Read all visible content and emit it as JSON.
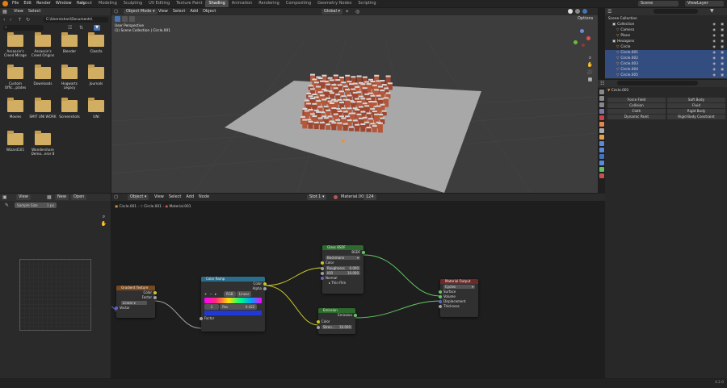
{
  "topbar": {
    "menus": [
      "File",
      "Edit",
      "Render",
      "Window",
      "Help"
    ],
    "workspaces": [
      "Layout",
      "Modeling",
      "Sculpting",
      "UV Editing",
      "Texture Paint",
      "Shading",
      "Animation",
      "Rendering",
      "Compositing",
      "Geometry Nodes",
      "Scripting"
    ],
    "active_workspace": "Shading",
    "scene": "Scene",
    "view_layer": "ViewLayer"
  },
  "file_browser": {
    "menus": [
      "View",
      "Select"
    ],
    "path": "C:\\Users\\shari\\Documents\\",
    "folders": [
      "Assassin's Creed Mirage",
      "Assassin's Creed Origins",
      "Blender",
      "Classfa",
      "Custom Offic...plates",
      "Downloads",
      "Hogwarts Legacy",
      "Journals",
      "Movies",
      "SMIT UNI WORK",
      "Screenshots",
      "UNI",
      "Wizard101",
      "Wondershare Demo...eror 8"
    ]
  },
  "viewport": {
    "mode": "Object Mode",
    "menus": [
      "View",
      "Select",
      "Add",
      "Object"
    ],
    "transform": "Global",
    "overlay_line1": "User Perspective",
    "overlay_line2": "(1) Scene Collection | Circle.001",
    "options": "Options"
  },
  "outliner": {
    "title": "Scene Collection",
    "rows": [
      {
        "label": "Collection",
        "sel": false,
        "indent": 1
      },
      {
        "label": "Camera",
        "sel": false,
        "indent": 2
      },
      {
        "label": "Plane",
        "sel": false,
        "indent": 2
      },
      {
        "label": "Hexagons",
        "sel": false,
        "indent": 1
      },
      {
        "label": "Circle",
        "sel": false,
        "indent": 2
      },
      {
        "label": "Circle.001",
        "sel": true,
        "indent": 2
      },
      {
        "label": "Circle.002",
        "sel": true,
        "indent": 2
      },
      {
        "label": "Circle.003",
        "sel": true,
        "indent": 2
      },
      {
        "label": "Circle.004",
        "sel": true,
        "indent": 2
      },
      {
        "label": "Circle.005",
        "sel": true,
        "indent": 2
      }
    ]
  },
  "properties": {
    "object": "Circle.001",
    "physics": [
      "Force Field",
      "Soft Body",
      "Collision",
      "Fluid",
      "Cloth",
      "Rigid Body",
      "Dynamic Paint",
      "Rigid Body Constraint"
    ]
  },
  "image_editor": {
    "view": "View",
    "new": "New",
    "open": "Open",
    "sample": "Sample Size",
    "sample_val": "1 px"
  },
  "node_editor": {
    "object": "Object",
    "menus": [
      "View",
      "Select",
      "Add",
      "Node"
    ],
    "slot": "Slot 1",
    "material": "Material.001",
    "users": "124",
    "breadcrumb": [
      "Circle.001",
      "Circle.001",
      "Material.001"
    ]
  },
  "nodes": {
    "gradient": {
      "title": "Gradient Texture",
      "out1": "Color",
      "out2": "Factor",
      "type": "Linear",
      "in1": "Vector"
    },
    "ramp": {
      "title": "Color Ramp",
      "out1": "Color",
      "out2": "Alpha",
      "mode": "RGB",
      "interp": "Linear",
      "idx": "2",
      "pos_label": "Pos",
      "pos": "0.422",
      "in1": "Factor"
    },
    "glass": {
      "title": "Glass BSDF",
      "out1": "BSDF",
      "dist": "Beckmann",
      "in1": "Color",
      "rough_label": "Roughness",
      "rough": "0.000",
      "ior_label": "IOR",
      "ior": "10.000",
      "in2": "Normal",
      "thin": "Thin Film"
    },
    "emission": {
      "title": "Emission",
      "out1": "Emission",
      "in1": "Color",
      "str_label": "Stren...",
      "str": "10.000"
    },
    "output": {
      "title": "Material Output",
      "target": "Cycles",
      "in1": "Surface",
      "in2": "Volume",
      "in3": "Displacement",
      "in4": "Thickness"
    }
  },
  "status": {
    "version": "4.2.0"
  }
}
